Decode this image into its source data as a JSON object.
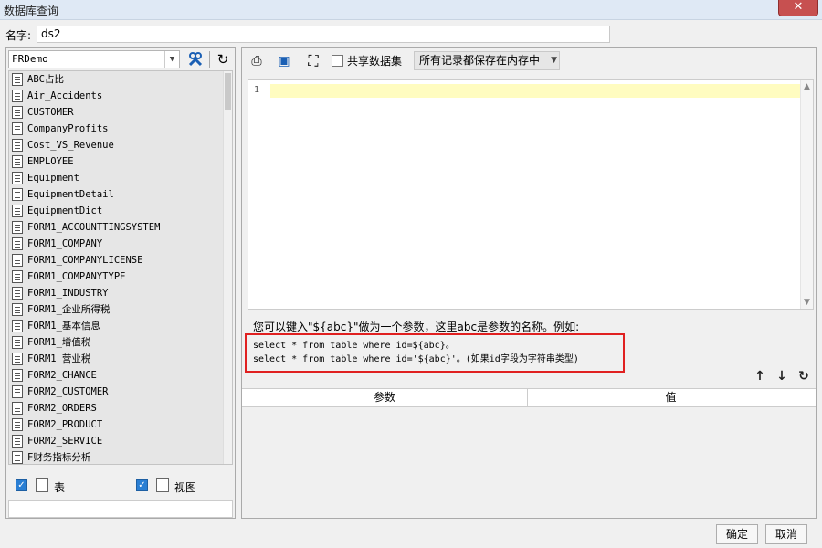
{
  "window": {
    "title": "数据库查询",
    "close_label": "✕"
  },
  "name_field": {
    "label": "名字:",
    "value": "ds2"
  },
  "datasource": {
    "selected": "FRDemo"
  },
  "table_list": {
    "items": [
      "ABC占比",
      "Air_Accidents",
      "CUSTOMER",
      "CompanyProfits",
      "Cost_VS_Revenue",
      "EMPLOYEE",
      "Equipment",
      "EquipmentDetail",
      "EquipmentDict",
      "FORM1_ACCOUNTTINGSYSTEM",
      "FORM1_COMPANY",
      "FORM1_COMPANYLICENSE",
      "FORM1_COMPANYTYPE",
      "FORM1_INDUSTRY",
      "FORM1_企业所得税",
      "FORM1_基本信息",
      "FORM1_增值税",
      "FORM1_营业税",
      "FORM2_CHANCE",
      "FORM2_CUSTOMER",
      "FORM2_ORDERS",
      "FORM2_PRODUCT",
      "FORM2_SERVICE",
      "F财务指标分析"
    ]
  },
  "filters": {
    "table_label": "表",
    "view_label": "视图",
    "table_checked": true,
    "view_checked": true
  },
  "toolbar": {
    "share_label": "共享数据集",
    "memory_option": "所有记录都保存在内存中"
  },
  "editor": {
    "line_number": "1",
    "content": ""
  },
  "hint": {
    "title": "您可以键入\"${abc}\"做为一个参数，这里abc是参数的名称。例如:",
    "line1": "select * from table where id=${abc}。",
    "line2": "select * from table where id='${abc}'。(如果id字段为字符串类型)"
  },
  "param_table": {
    "col_param": "参数",
    "col_value": "值"
  },
  "footer": {
    "ok_label": "确定",
    "cancel_label": "取消"
  },
  "colors": {
    "highlight_border": "#e02020",
    "active_line": "#fffcc0",
    "checkbox_accent": "#2a7fd4"
  }
}
